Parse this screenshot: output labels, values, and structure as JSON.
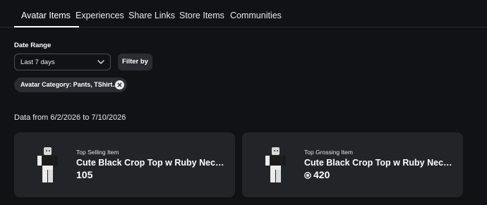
{
  "tabs": [
    {
      "label": "Avatar Items",
      "active": true
    },
    {
      "label": "Experiences",
      "active": false
    },
    {
      "label": "Share Links",
      "active": false
    },
    {
      "label": "Store Items",
      "active": false
    },
    {
      "label": "Communities",
      "active": false
    }
  ],
  "filters": {
    "date_range_label": "Date Range",
    "date_range_value": "Last 7 days",
    "filter_button": "Filter by",
    "chip_label": "Avatar Category: Pants, TShirt..."
  },
  "range_text": "Data from 6/2/2026 to 7/10/2026",
  "cards": [
    {
      "kicker": "Top Selling Item",
      "title": "Cute Black Crop Top w Ruby Necklace",
      "value": "105",
      "icon": "avatar-thumbnail"
    },
    {
      "kicker": "Top Grossing Item",
      "title": "Cute Black Crop Top w Ruby Necklace",
      "value": "420",
      "value_icon": "robux-icon",
      "icon": "avatar-thumbnail"
    }
  ],
  "colors": {
    "background": "#111216",
    "card": "#232428",
    "chip": "#2a2c31",
    "text": "#ffffff"
  }
}
